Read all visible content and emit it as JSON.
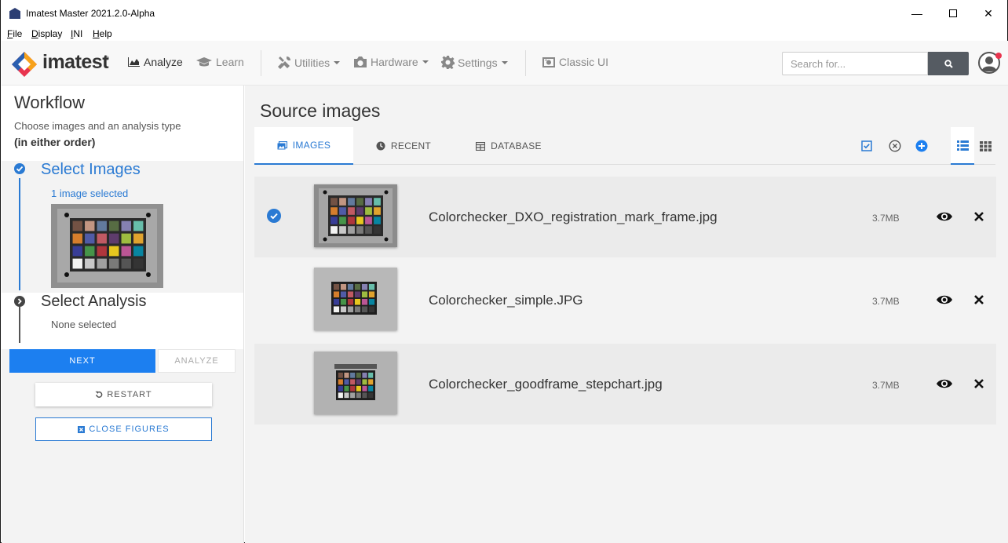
{
  "window": {
    "title": "Imatest Master 2021.2.0-Alpha",
    "minimize": "—",
    "close": "✕"
  },
  "menubar": {
    "items": [
      {
        "ul": "F",
        "rest": "ile"
      },
      {
        "ul": "D",
        "rest": "isplay"
      },
      {
        "ul": "I",
        "rest": "NI"
      },
      {
        "ul": "H",
        "rest": "elp"
      }
    ]
  },
  "navbar": {
    "logo_text": "imatest",
    "logo_reg": "®",
    "analyze": "Analyze",
    "learn": "Learn",
    "utilities": "Utilities",
    "hardware": "Hardware",
    "settings": "Settings",
    "classic_ui": "Classic UI",
    "search_placeholder": "Search for..."
  },
  "sidebar": {
    "title": "Workflow",
    "subtitle": "Choose images and an analysis type",
    "subtitle_bold": "(in either order)",
    "step1": {
      "title": "Select Images",
      "sub": "1 image selected"
    },
    "step2": {
      "title": "Select Analysis",
      "sub": "None selected"
    },
    "next": "NEXT",
    "analyze": "ANALYZE",
    "restart": "RESTART",
    "close_figures": "CLOSE FIGURES"
  },
  "main": {
    "title": "Source images",
    "tabs": {
      "images": "IMAGES",
      "recent": "RECENT",
      "database": "DATABASE"
    },
    "files": [
      {
        "name": "Colorchecker_DXO_registration_mark_frame.jpg",
        "size": "3.7MB",
        "selected": true
      },
      {
        "name": "Colorchecker_simple.JPG",
        "size": "3.7MB",
        "selected": false
      },
      {
        "name": "Colorchecker_goodframe_stepchart.jpg",
        "size": "3.7MB",
        "selected": false
      }
    ]
  },
  "colors": {
    "accent": "#2a7ad3",
    "primary_button": "#1c7ff0",
    "search_button": "#555b62",
    "notification": "#e8344e"
  }
}
